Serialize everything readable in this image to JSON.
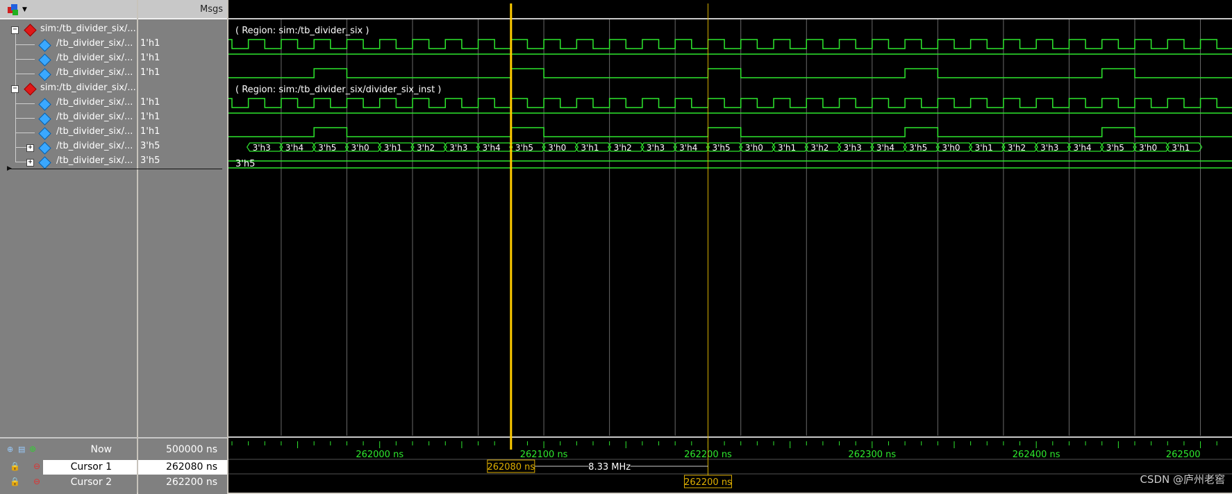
{
  "header": {
    "msgs_label": "Msgs"
  },
  "rows": [
    {
      "name": "sim:/tb_divider_six/...",
      "value": "",
      "kind": "group"
    },
    {
      "name": "/tb_divider_six/...",
      "value": "1'h1",
      "kind": "signal"
    },
    {
      "name": "/tb_divider_six/...",
      "value": "1'h1",
      "kind": "signal"
    },
    {
      "name": "/tb_divider_six/...",
      "value": "1'h1",
      "kind": "signal"
    },
    {
      "name": "sim:/tb_divider_six/...",
      "value": "",
      "kind": "group"
    },
    {
      "name": "/tb_divider_six/...",
      "value": "1'h1",
      "kind": "signal"
    },
    {
      "name": "/tb_divider_six/...",
      "value": "1'h1",
      "kind": "signal"
    },
    {
      "name": "/tb_divider_six/...",
      "value": "1'h1",
      "kind": "signal"
    },
    {
      "name": "/tb_divider_six/...",
      "value": "3'h5",
      "kind": "bus"
    },
    {
      "name": "/tb_divider_six/...",
      "value": "3'h5",
      "kind": "bus"
    }
  ],
  "regions": [
    "( Region: sim:/tb_divider_six )",
    "( Region: sim:/tb_divider_six/divider_six_inst )"
  ],
  "bus_values": [
    "3'h3",
    "3'h4",
    "3'h5",
    "3'h0",
    "3'h1",
    "3'h2",
    "3'h3",
    "3'h4",
    "3'h5",
    "3'h0",
    "3'h1",
    "3'h2",
    "3'h3",
    "3'h4",
    "3'h5",
    "3'h0",
    "3'h1",
    "3'h2",
    "3'h3",
    "3'h4",
    "3'h5",
    "3'h0",
    "3'h1",
    "3'h2",
    "3'h3",
    "3'h4",
    "3'h5",
    "3'h0",
    "3'h1"
  ],
  "bus2_value": "3'h5",
  "timeline": {
    "ticks": [
      "262000 ns",
      "262100 ns",
      "262200 ns",
      "262300 ns",
      "262400 ns",
      "262500"
    ],
    "tick_times_ns": [
      262000,
      262100,
      262200,
      262300,
      262400,
      262500
    ]
  },
  "bottom": {
    "now_label": "Now",
    "now_value": "500000 ns",
    "cursor1_label": "Cursor 1",
    "cursor1_value": "262080 ns",
    "cursor2_label": "Cursor 2",
    "cursor2_value": "262200 ns",
    "cursor1_box": "262080 ns",
    "cursor2_box": "262200 ns",
    "delta_label": "8.33 MHz"
  },
  "watermark": "CSDN @庐州老窖",
  "colors": {
    "wave": "#2ee82e",
    "cursor1": "#ffcc00",
    "cursor2": "#d8b000",
    "grid": "#6a6a6a"
  }
}
